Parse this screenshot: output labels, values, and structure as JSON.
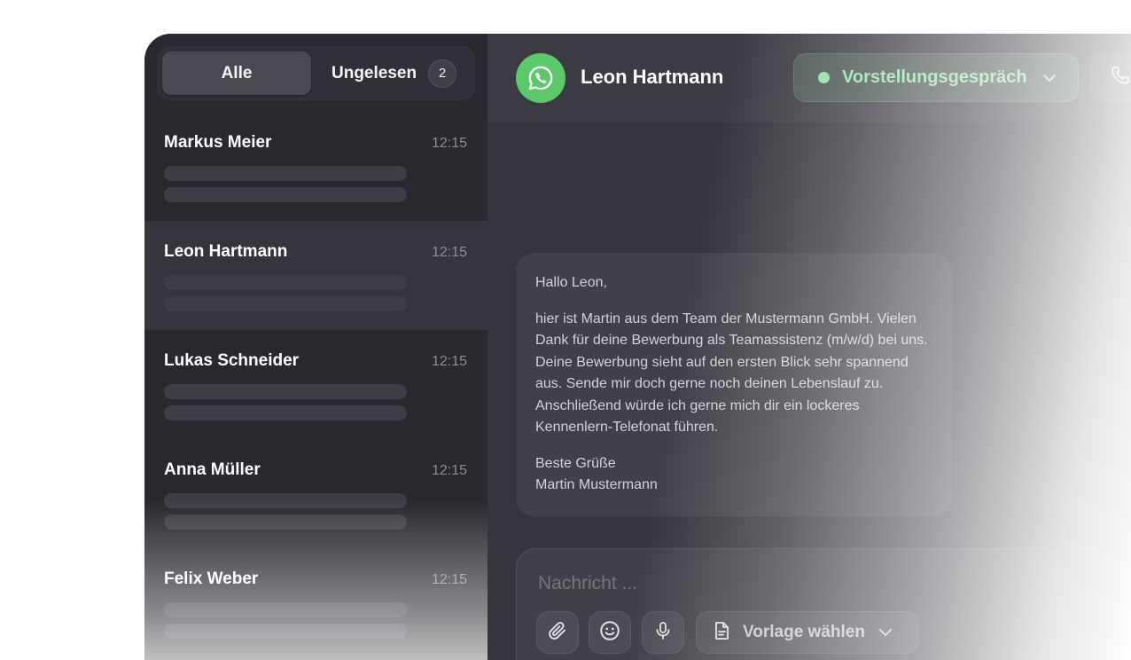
{
  "filter_tabs": {
    "all_label": "Alle",
    "unread_label": "Ungelesen",
    "unread_count": "2"
  },
  "contacts": [
    {
      "name": "Markus Meier",
      "time": "12:15",
      "active": false
    },
    {
      "name": "Leon Hartmann",
      "time": "12:15",
      "active": true
    },
    {
      "name": "Lukas Schneider",
      "time": "12:15",
      "active": false
    },
    {
      "name": "Anna Müller",
      "time": "12:15",
      "active": false
    },
    {
      "name": "Felix Weber",
      "time": "12:15",
      "active": false
    }
  ],
  "chat_header": {
    "contact_name": "Leon Hartmann",
    "avatar_icon": "whatsapp-icon",
    "status_label": "Vorstellungsgespräch",
    "status_color": "#8fe0a1",
    "call_icon": "phone-icon"
  },
  "message": {
    "greeting": "Hallo Leon,",
    "body": "hier ist Martin aus dem Team der Mustermann GmbH. Vielen Dank für deine Bewerbung als Teamassistenz (m/w/d) bei uns. Deine Bewerbung sieht auf den ersten Blick sehr spannend aus. Sende mir doch gerne noch deinen Lebenslauf zu. Anschließend würde ich gerne mich dir ein lockeres Kennenlern-Telefonat führen.",
    "closing": "Beste Grüße",
    "signature": "Martin Mustermann"
  },
  "composer": {
    "placeholder": "Nachricht ...",
    "template_label": "Vorlage wählen",
    "tools": [
      "paperclip-icon",
      "smiley-icon",
      "microphone-icon",
      "document-icon"
    ]
  },
  "colors": {
    "accent_green": "#5bc86a",
    "app_dark": "#29282f",
    "panel": "#36353d"
  }
}
